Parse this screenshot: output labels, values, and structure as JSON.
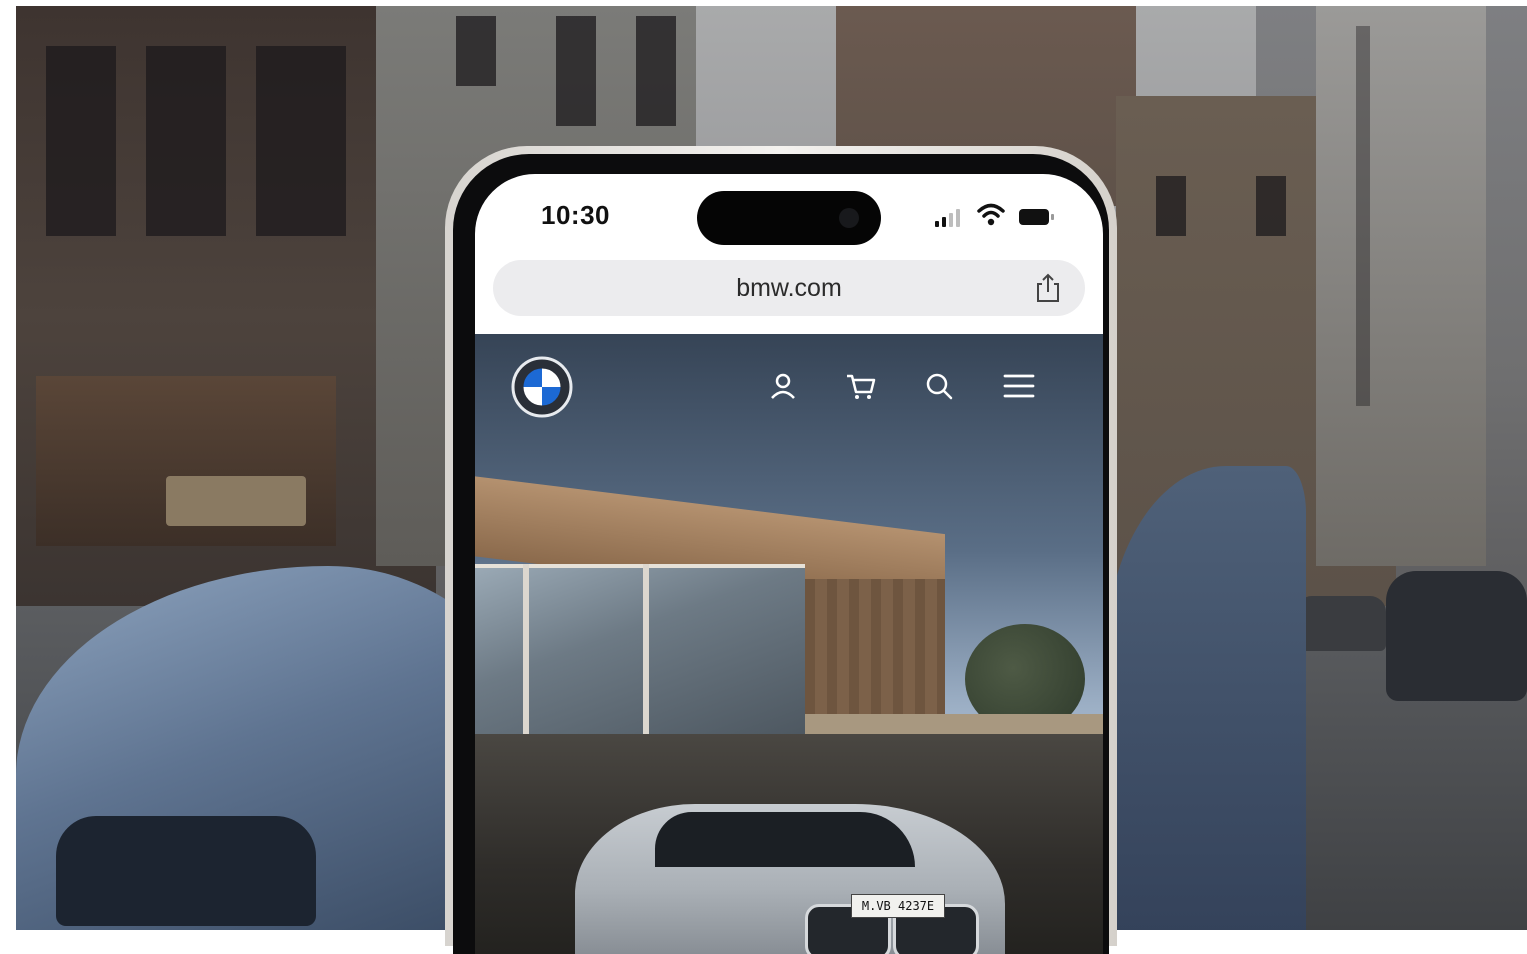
{
  "status_bar": {
    "time": "10:30",
    "icons": [
      "signal-icon",
      "wifi-icon",
      "battery-icon"
    ]
  },
  "browser": {
    "url": "bmw.com",
    "share_icon": "share-icon"
  },
  "site": {
    "logo": "bmw-logo",
    "nav_icons": [
      "account-icon",
      "cart-icon",
      "search-icon",
      "menu-icon"
    ],
    "hero": {
      "license_plate": "M.VB 4237E"
    }
  },
  "colors": {
    "bmw_blue": "#1c69d4",
    "phone_frame": "#e9e6e1",
    "url_bar": "#ececee"
  }
}
